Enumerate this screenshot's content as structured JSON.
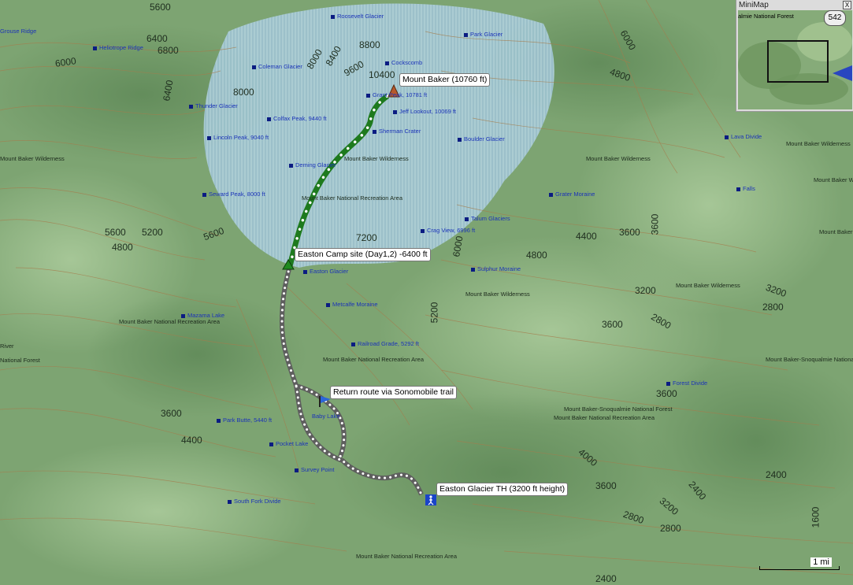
{
  "colors": {
    "terrain": "#7da472",
    "glacier": "#b9d7e6",
    "route_up": "#1d7a1d",
    "route_return": "#8a8a8a",
    "poi": "#1b33b8",
    "contour": "#a07a4a"
  },
  "elevations": [
    {
      "t": "5600"
    },
    {
      "t": "6400"
    },
    {
      "t": "6800"
    },
    {
      "t": "6000"
    },
    {
      "t": "6400"
    },
    {
      "t": "8000"
    },
    {
      "t": "8000"
    },
    {
      "t": "8400"
    },
    {
      "t": "8800"
    },
    {
      "t": "9600"
    },
    {
      "t": "10400"
    },
    {
      "t": "6000"
    },
    {
      "t": "4800"
    },
    {
      "t": "5600"
    },
    {
      "t": "5200"
    },
    {
      "t": "4800"
    },
    {
      "t": "5600"
    },
    {
      "t": "7200"
    },
    {
      "t": "6000"
    },
    {
      "t": "4800"
    },
    {
      "t": "4400"
    },
    {
      "t": "3600"
    },
    {
      "t": "3600"
    },
    {
      "t": "5200"
    },
    {
      "t": "3200"
    },
    {
      "t": "2800"
    },
    {
      "t": "3600"
    },
    {
      "t": "2800"
    },
    {
      "t": "3200"
    },
    {
      "t": "3600"
    },
    {
      "t": "3600"
    },
    {
      "t": "4400"
    },
    {
      "t": "4000"
    },
    {
      "t": "3600"
    },
    {
      "t": "3200"
    },
    {
      "t": "2400"
    },
    {
      "t": "2400"
    },
    {
      "t": "2800"
    },
    {
      "t": "2800"
    },
    {
      "t": "1600"
    },
    {
      "t": "2400"
    }
  ],
  "pois": [
    {
      "t": "Roosevelt Glacier"
    },
    {
      "t": "Park Glacier"
    },
    {
      "t": "Grouse Ridge"
    },
    {
      "t": "Heliotrope Ridge"
    },
    {
      "t": "Coleman Glacier"
    },
    {
      "t": "Cockscomb"
    },
    {
      "t": "Thunder Glacier"
    },
    {
      "t": "Colfax Peak, 9440 ft"
    },
    {
      "t": "Lincoln Peak, 9040 ft"
    },
    {
      "t": "Sherman Crater"
    },
    {
      "t": "Boulder Glacier"
    },
    {
      "t": "Deming Glacier"
    },
    {
      "t": "Seward Peak, 8000 ft"
    },
    {
      "t": "Grater Moraine"
    },
    {
      "t": "Talum Glaciers"
    },
    {
      "t": "Crag View, 6996 ft"
    },
    {
      "t": "Easton Glacier"
    },
    {
      "t": "Sulphur Moraine"
    },
    {
      "t": "Metcalfe Moraine"
    },
    {
      "t": "Mazama Lake"
    },
    {
      "t": "Railroad Grade, 5292 ft"
    },
    {
      "t": "Forest Divide"
    },
    {
      "t": "Park Butte, 5440 ft"
    },
    {
      "t": "Pocket Lake"
    },
    {
      "t": "Survey Point"
    },
    {
      "t": "South Fork Divide"
    },
    {
      "t": "Baby Lake"
    },
    {
      "t": "Lava Divide"
    },
    {
      "t": "Falls"
    },
    {
      "t": "Grant Peak, 10781 ft"
    },
    {
      "t": "Jeff Lookout, 10069 ft"
    }
  ],
  "areas": [
    {
      "t": "Mount Baker Wilderness"
    },
    {
      "t": "Mount Baker Wilderness"
    },
    {
      "t": "Mount Baker National Recreation Area"
    },
    {
      "t": "Mount Baker Wilderness"
    },
    {
      "t": "Mount Baker Wilderness"
    },
    {
      "t": "Mount Baker National Recreation Area"
    },
    {
      "t": "Mount Baker National Recreation Area"
    },
    {
      "t": "Mount Baker Wilderness"
    },
    {
      "t": "Mount Baker-Snoqualmie National Forest"
    },
    {
      "t": "Mount Baker National Recreation Area"
    },
    {
      "t": "Mount Baker National Recreation Area"
    },
    {
      "t": "Mount Baker Wilderness"
    },
    {
      "t": "Mount Baker Wilderness"
    },
    {
      "t": "Mount Baker Wilderness"
    },
    {
      "t": "Mount Baker-Snoqualmie National Forest"
    },
    {
      "t": "River"
    },
    {
      "t": "National Forest"
    }
  ],
  "callouts": {
    "summit": "Mount  Baker (10760 ft)",
    "camp": "Easton Camp site (Day1,2) -6400 ft",
    "return": "Return route via Sonomobile trail",
    "trailhead": "Easton Glacier TH (3200 ft height)"
  },
  "minimap": {
    "title": "MiniMap",
    "close": "X",
    "label": "almie National Forest",
    "zoom": "542"
  },
  "scale": {
    "label": "1 mi",
    "miles": 1
  }
}
